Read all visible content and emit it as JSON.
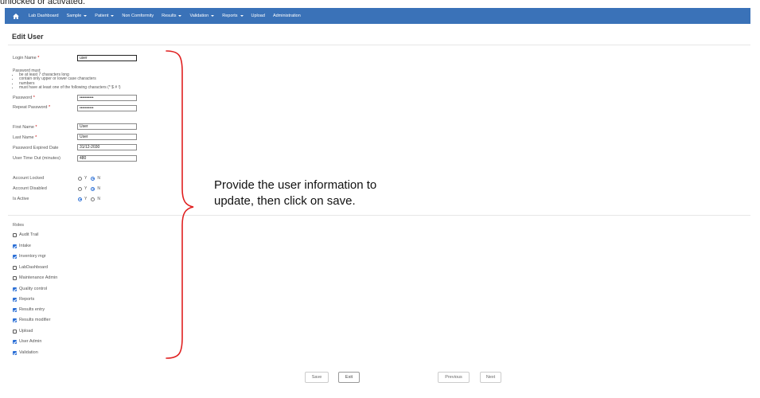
{
  "caption": "unlocked or activated.",
  "nav": {
    "home_icon": "home-icon",
    "items": [
      {
        "label": "Lab Dashboard",
        "has_caret": false
      },
      {
        "label": "Sample",
        "has_caret": true
      },
      {
        "label": "Patient",
        "has_caret": true
      },
      {
        "label": "Non Comformity",
        "has_caret": false
      },
      {
        "label": "Results",
        "has_caret": true
      },
      {
        "label": "Validation",
        "has_caret": true
      },
      {
        "label": "Reports",
        "has_caret": true
      },
      {
        "label": "Upload",
        "has_caret": false
      },
      {
        "label": "Administration",
        "has_caret": false
      }
    ]
  },
  "page": {
    "title": "Edit User"
  },
  "form": {
    "login_name": {
      "label": "Login Name",
      "value": "user"
    },
    "password_rules": {
      "heading": "Password must:",
      "rules": [
        "be at least 7 characters long",
        "contain only upper or lower case characters",
        "numbers",
        "must have at least one of the following characters (* $ # !)"
      ]
    },
    "password": {
      "label": "Password",
      "value": "••••••••••"
    },
    "repeat_password": {
      "label": "Repeat Password",
      "value": "••••••••••"
    },
    "first_name": {
      "label": "First Name",
      "value": "User"
    },
    "last_name": {
      "label": "Last Name",
      "value": "User"
    },
    "password_expired_date": {
      "label": "Password Expired Date",
      "value": "31/12-2030"
    },
    "user_timeout": {
      "label": "User Time Out (minutes)",
      "value": "480"
    },
    "account_locked": {
      "label": "Account Locked",
      "yes": "Y",
      "no": "N",
      "selected": "N"
    },
    "account_disabled": {
      "label": "Account Disabled",
      "yes": "Y",
      "no": "N",
      "selected": "N"
    },
    "is_active": {
      "label": "Is Active",
      "yes": "Y",
      "no": "N",
      "selected": "Y"
    }
  },
  "roles": {
    "title": "Roles",
    "items": [
      {
        "label": "Audit Trail",
        "checked": false
      },
      {
        "label": "Intake",
        "checked": true
      },
      {
        "label": "Inventory mgr",
        "checked": true
      },
      {
        "label": "LabDashboard",
        "checked": false
      },
      {
        "label": "Maintenance Admin",
        "checked": false
      },
      {
        "label": "Quality control",
        "checked": true
      },
      {
        "label": "Reports",
        "checked": true
      },
      {
        "label": "Results entry",
        "checked": true
      },
      {
        "label": "Results modifier",
        "checked": true
      },
      {
        "label": "Upload",
        "checked": false
      },
      {
        "label": "User Admin",
        "checked": true
      },
      {
        "label": "Validation",
        "checked": true
      }
    ]
  },
  "annotation": {
    "line1": "Provide the user information to",
    "line2": "update, then click on save.",
    "brace_color": "#e02020"
  },
  "buttons": {
    "save": "Save",
    "exit": "Exit",
    "previous": "Previous",
    "next": "Next"
  },
  "colors": {
    "nav_bg": "#3a72b8",
    "accent": "#2b6fd6",
    "required": "#cc0000"
  }
}
